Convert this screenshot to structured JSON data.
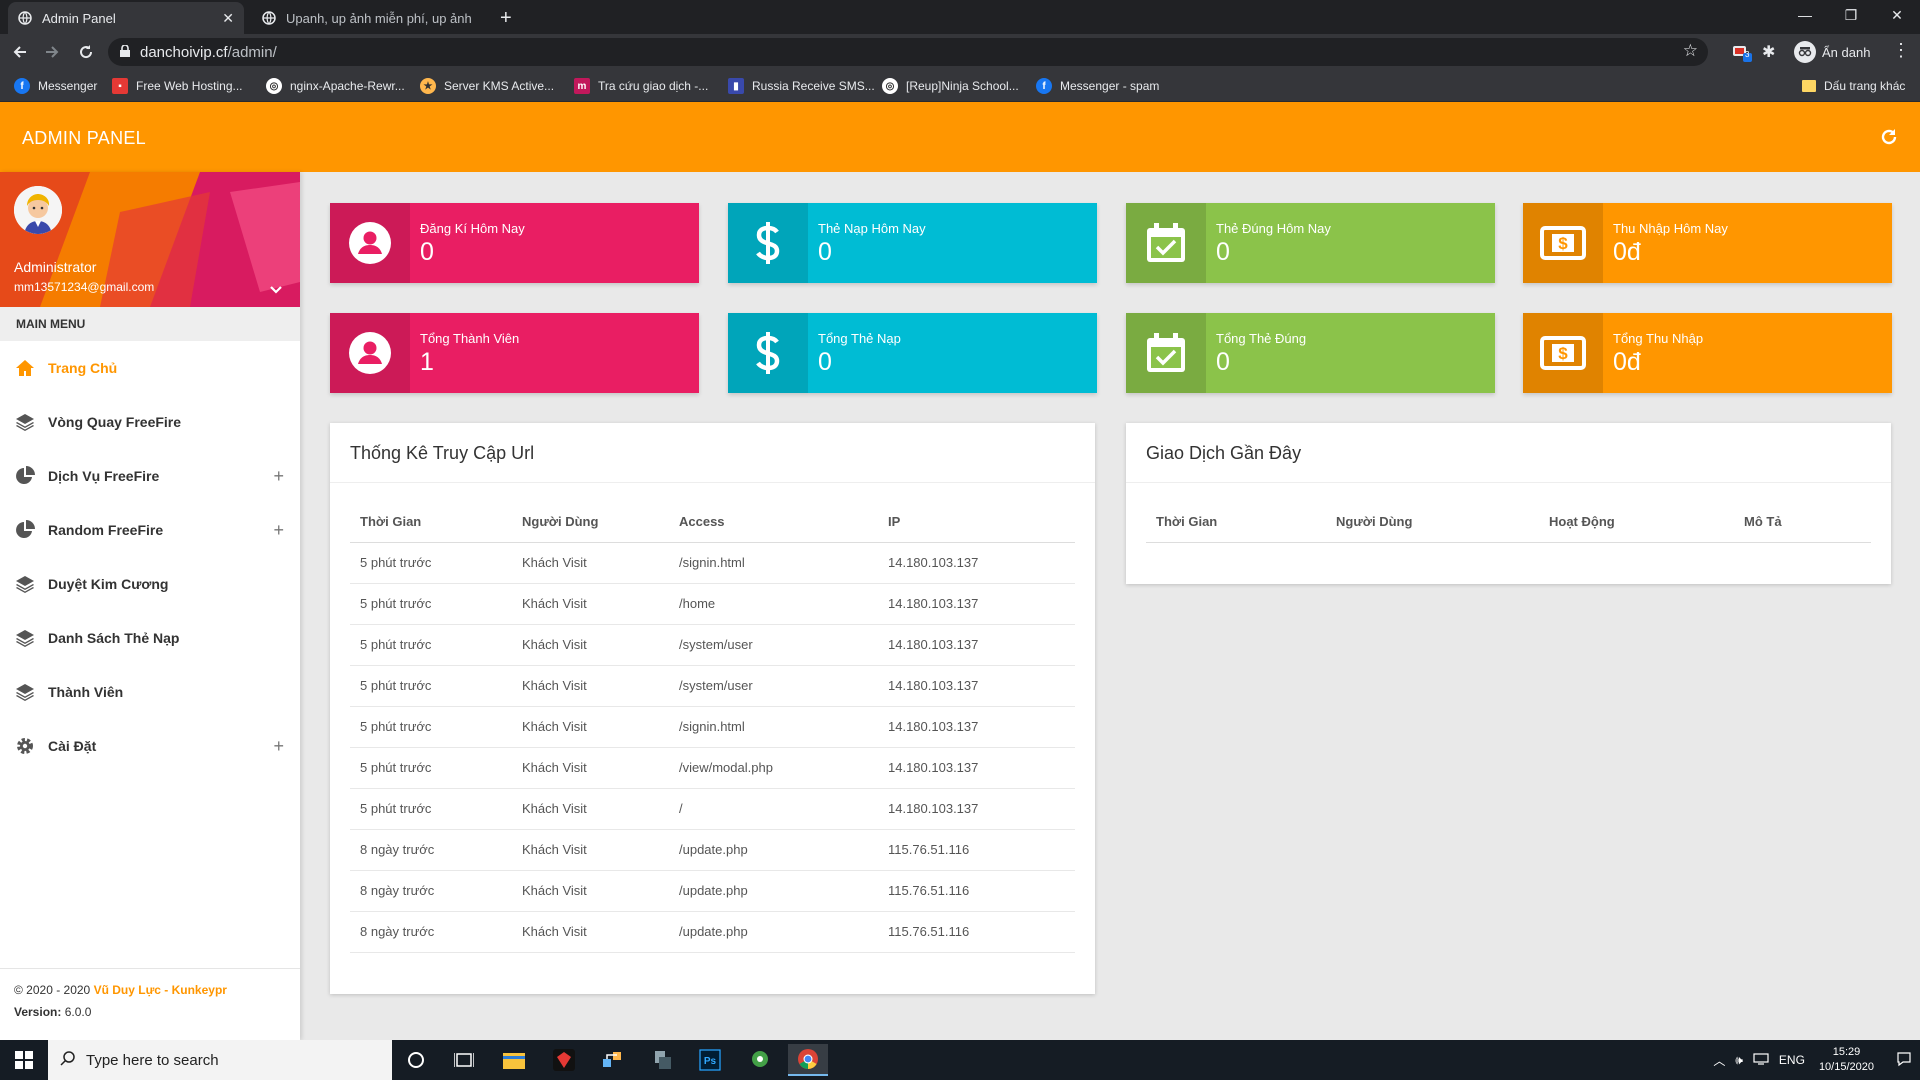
{
  "browser": {
    "tabs": [
      {
        "title": "Admin Panel",
        "active": true
      },
      {
        "title": "Upanh, up ảnh miễn phí, up ảnh",
        "active": false
      }
    ],
    "new_tab": "+",
    "url_host": "danchoivip.cf",
    "url_path": "/admin/",
    "profile_label": "Ẩn danh",
    "bookmarks": [
      "Messenger",
      "Free Web Hosting...",
      "nginx-Apache-Rewr...",
      "Server KMS Active...",
      "Tra cứu giao dịch -...",
      "Russia Receive SMS...",
      "[Reup]Ninja School...",
      "Messenger - spam"
    ],
    "other_bookmarks": "Dấu trang khác",
    "extension_badge": "3"
  },
  "header": {
    "title": "ADMIN PANEL",
    "color": "#ff9600"
  },
  "user": {
    "name": "Administrator",
    "email": "mm13571234@gmail.com"
  },
  "menu": {
    "header": "MAIN MENU",
    "items": [
      {
        "label": "Trang Chủ",
        "icon": "home-icon",
        "active": true,
        "expandable": false
      },
      {
        "label": "Vòng Quay FreeFire",
        "icon": "layers-icon",
        "active": false,
        "expandable": false
      },
      {
        "label": "Dịch Vụ FreeFire",
        "icon": "pie-chart-icon",
        "active": false,
        "expandable": true
      },
      {
        "label": "Random FreeFire",
        "icon": "pie-chart-icon",
        "active": false,
        "expandable": true
      },
      {
        "label": "Duyệt Kim Cương",
        "icon": "layers-icon",
        "active": false,
        "expandable": false
      },
      {
        "label": "Danh Sách Thẻ Nạp",
        "icon": "layers-icon",
        "active": false,
        "expandable": false
      },
      {
        "label": "Thành Viên",
        "icon": "layers-icon",
        "active": false,
        "expandable": false
      },
      {
        "label": "Cài Đặt",
        "icon": "gear-icon",
        "active": false,
        "expandable": true
      }
    ],
    "expand_symbol": "+"
  },
  "footer": {
    "copyright": "© 2020 - 2020 ",
    "author": "Vũ Duy Lực - Kunkeypr",
    "version_label": "Version: ",
    "version": "6.0.0"
  },
  "stats": [
    {
      "label": "Đăng Kí Hôm Nay",
      "value": "0",
      "color": "#e91e63",
      "icon": "user-icon"
    },
    {
      "label": "Thẻ Nạp Hôm Nay",
      "value": "0",
      "color": "#00bcd4",
      "icon": "dollar-icon"
    },
    {
      "label": "Thẻ Đúng Hôm Nay",
      "value": "0",
      "color": "#8bc34a",
      "icon": "calendar-check-icon"
    },
    {
      "label": "Thu Nhập Hôm Nay",
      "value": "0đ",
      "color": "#ff9600",
      "icon": "money-icon"
    },
    {
      "label": "Tổng Thành Viên",
      "value": "1",
      "color": "#e91e63",
      "icon": "user-icon"
    },
    {
      "label": "Tổng Thẻ Nạp",
      "value": "0",
      "color": "#00bcd4",
      "icon": "dollar-icon"
    },
    {
      "label": "Tổng Thẻ Đúng",
      "value": "0",
      "color": "#8bc34a",
      "icon": "calendar-check-icon"
    },
    {
      "label": "Tổng Thu Nhập",
      "value": "0đ",
      "color": "#ff9600",
      "icon": "money-icon"
    }
  ],
  "url_stats": {
    "title": "Thống Kê Truy Cập Url",
    "columns": [
      "Thời Gian",
      "Người Dùng",
      "Access",
      "IP"
    ],
    "rows": [
      [
        "5 phút trước",
        "Khách Visit",
        "/signin.html",
        "14.180.103.137"
      ],
      [
        "5 phút trước",
        "Khách Visit",
        "/home",
        "14.180.103.137"
      ],
      [
        "5 phút trước",
        "Khách Visit",
        "/system/user",
        "14.180.103.137"
      ],
      [
        "5 phút trước",
        "Khách Visit",
        "/system/user",
        "14.180.103.137"
      ],
      [
        "5 phút trước",
        "Khách Visit",
        "/signin.html",
        "14.180.103.137"
      ],
      [
        "5 phút trước",
        "Khách Visit",
        "/view/modal.php",
        "14.180.103.137"
      ],
      [
        "5 phút trước",
        "Khách Visit",
        "/",
        "14.180.103.137"
      ],
      [
        "8 ngày trước",
        "Khách Visit",
        "/update.php",
        "115.76.51.116"
      ],
      [
        "8 ngày trước",
        "Khách Visit",
        "/update.php",
        "115.76.51.116"
      ],
      [
        "8 ngày trước",
        "Khách Visit",
        "/update.php",
        "115.76.51.116"
      ]
    ]
  },
  "transactions": {
    "title": "Giao Dịch Gần Đây",
    "columns": [
      "Thời Gian",
      "Người Dùng",
      "Hoạt Động",
      "Mô Tả"
    ],
    "rows": []
  },
  "taskbar": {
    "search_placeholder": "Type here to search",
    "language": "ENG",
    "time": "15:29",
    "date": "10/15/2020"
  }
}
